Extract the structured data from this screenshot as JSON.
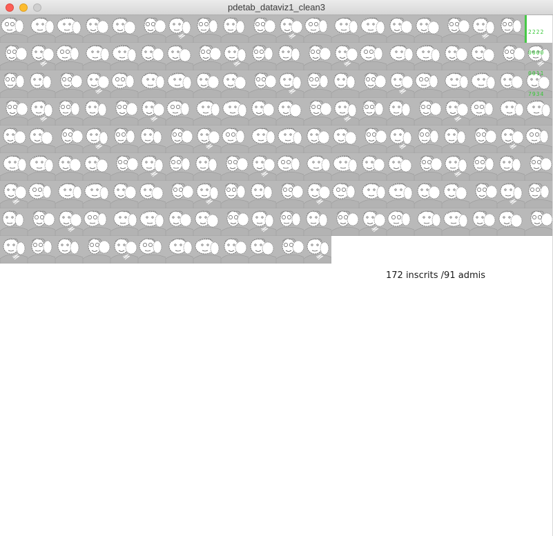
{
  "window": {
    "title": "pdetab_dataviz1_clean3"
  },
  "grid": {
    "tile_count": 172,
    "columns": 20,
    "tile_color": "#b9b9b9",
    "icon": "caricature-portrait-icon"
  },
  "digit_panel": {
    "rows": [
      "2222",
      "0000",
      "0011",
      "7934"
    ],
    "color": "#37c837"
  },
  "stats": {
    "text": "172 inscrits /91 admis"
  }
}
